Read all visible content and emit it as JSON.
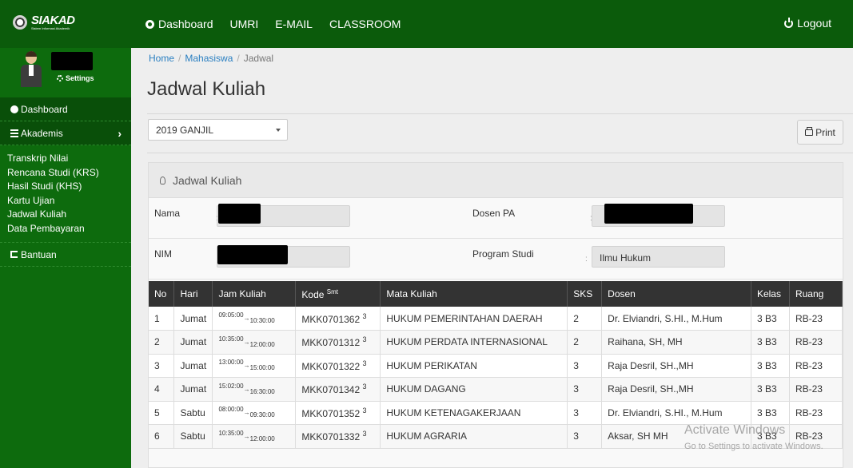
{
  "brand": {
    "name": "SIAKAD",
    "sub": "Sistem Informasi Akademik"
  },
  "nav": {
    "items": [
      "Dashboard",
      "UMRI",
      "E-MAIL",
      "CLASSROOM"
    ],
    "logout": "Logout"
  },
  "sidebar": {
    "settings": "Settings",
    "dashboard": "Dashboard",
    "akademis": "Akademis",
    "submenu": [
      "Transkrip Nilai",
      "Rencana Studi (KRS)",
      "Hasil Studi (KHS)",
      "Kartu Ujian",
      "Jadwal Kuliah",
      "Data Pembayaran"
    ],
    "bantuan": "Bantuan"
  },
  "breadcrumb": {
    "home": "Home",
    "mahasiswa": "Mahasiswa",
    "current": "Jadwal"
  },
  "page_title": "Jadwal Kuliah",
  "semester_select": {
    "value": "2019 GANJIL"
  },
  "print_label": "Print",
  "panel": {
    "title": "Jadwal Kuliah",
    "nama_label": "Nama",
    "nim_label": "NIM",
    "dosen_pa_label": "Dosen PA",
    "program_studi_label": "Program Studi",
    "program_studi_value": "Ilmu Hukum",
    "colon": ":"
  },
  "table": {
    "headers": [
      "No",
      "Hari",
      "Jam Kuliah",
      "Kode",
      "Mata Kuliah",
      "SKS",
      "Dosen",
      "Kelas",
      "Ruang"
    ],
    "kode_sup": "Smt",
    "rows": [
      {
        "no": "1",
        "hari": "Jumat",
        "start": "09:05:00",
        "end": "10:30:00",
        "kode": "MKK0701362",
        "smt": "3",
        "mk": "HUKUM PEMERINTAHAN DAERAH",
        "sks": "2",
        "dosen": "Dr. Elviandri, S.HI., M.Hum",
        "kelas": "3 B3",
        "ruang": "RB-23"
      },
      {
        "no": "2",
        "hari": "Jumat",
        "start": "10:35:00",
        "end": "12:00:00",
        "kode": "MKK0701312",
        "smt": "3",
        "mk": "HUKUM PERDATA INTERNASIONAL",
        "sks": "2",
        "dosen": "Raihana, SH, MH",
        "kelas": "3 B3",
        "ruang": "RB-23"
      },
      {
        "no": "3",
        "hari": "Jumat",
        "start": "13:00:00",
        "end": "15:00:00",
        "kode": "MKK0701322",
        "smt": "3",
        "mk": "HUKUM PERIKATAN",
        "sks": "3",
        "dosen": "Raja Desril, SH.,MH",
        "kelas": "3 B3",
        "ruang": "RB-23"
      },
      {
        "no": "4",
        "hari": "Jumat",
        "start": "15:02:00",
        "end": "16:30:00",
        "kode": "MKK0701342",
        "smt": "3",
        "mk": "HUKUM DAGANG",
        "sks": "3",
        "dosen": "Raja Desril, SH.,MH",
        "kelas": "3 B3",
        "ruang": "RB-23"
      },
      {
        "no": "5",
        "hari": "Sabtu",
        "start": "08:00:00",
        "end": "09:30:00",
        "kode": "MKK0701352",
        "smt": "3",
        "mk": "HUKUM KETENAGAKERJAAN",
        "sks": "3",
        "dosen": "Dr. Elviandri, S.HI., M.Hum",
        "kelas": "3 B3",
        "ruang": "RB-23"
      },
      {
        "no": "6",
        "hari": "Sabtu",
        "start": "10:35:00",
        "end": "12:00:00",
        "kode": "MKK0701332",
        "smt": "3",
        "mk": "HUKUM AGRARIA",
        "sks": "3",
        "dosen": "Aksar, SH MH",
        "kelas": "3 B3",
        "ruang": "RB-23"
      }
    ]
  },
  "watermark": {
    "line1": "Activate Windows",
    "line2": "Go to Settings to activate Windows."
  }
}
